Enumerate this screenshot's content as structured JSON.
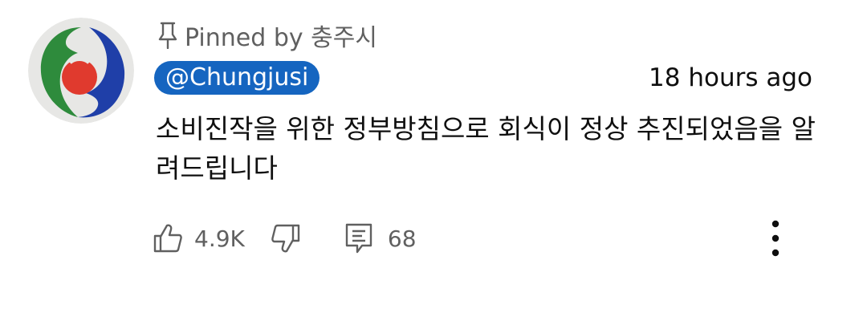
{
  "comment": {
    "pinned_text": "Pinned by 충주시",
    "author_handle": "@Chungjusi",
    "timestamp": "18 hours ago",
    "body": "소비진작을 위한 정부방침으로 회식이 정상 추진되었음을 알려드립니다",
    "likes": "4.9K",
    "replies": "68"
  },
  "icons": {
    "pin": "pin-icon",
    "like": "thumbs-up-icon",
    "dislike": "thumbs-down-icon",
    "reply": "comment-icon",
    "more": "more-vertical-icon"
  },
  "colors": {
    "handle_badge": "#1565c0",
    "secondary_text": "#606060",
    "primary_text": "#0f0f0f",
    "logo_green": "#2e8b3c",
    "logo_blue": "#1f3fa8",
    "logo_red": "#e03a2e"
  }
}
